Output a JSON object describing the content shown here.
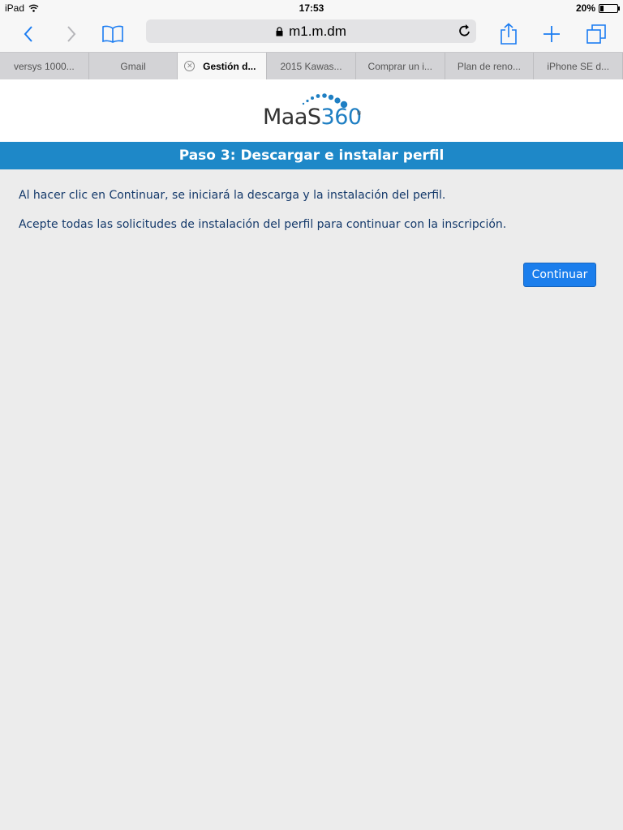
{
  "status": {
    "device": "iPad",
    "time": "17:53",
    "battery": "20%",
    "battery_level": 0.2
  },
  "browser": {
    "url": "m1.m.dm",
    "tabs": [
      {
        "label": "versys 1000..."
      },
      {
        "label": "Gmail"
      },
      {
        "label": "Gestión d..."
      },
      {
        "label": "2015 Kawas..."
      },
      {
        "label": "Comprar un i..."
      },
      {
        "label": "Plan de reno..."
      },
      {
        "label": "iPhone SE d..."
      }
    ],
    "active_tab_index": 2
  },
  "logo": {
    "maas": "MaaS",
    "num": "360",
    "reg": "®"
  },
  "step": {
    "title": "Paso 3:  Descargar e instalar perfil"
  },
  "content": {
    "line1": "Al hacer clic en Continuar, se iniciará la descarga y la instalación del perfil.",
    "line2": "Acepte todas las solicitudes de instalación del perfil para continuar con la inscripción.",
    "continue_label": "Continuar"
  },
  "colors": {
    "accent": "#1e88c8",
    "button": "#1b7eec",
    "text": "#153a6b",
    "ios_blue": "#1a7cf2"
  }
}
